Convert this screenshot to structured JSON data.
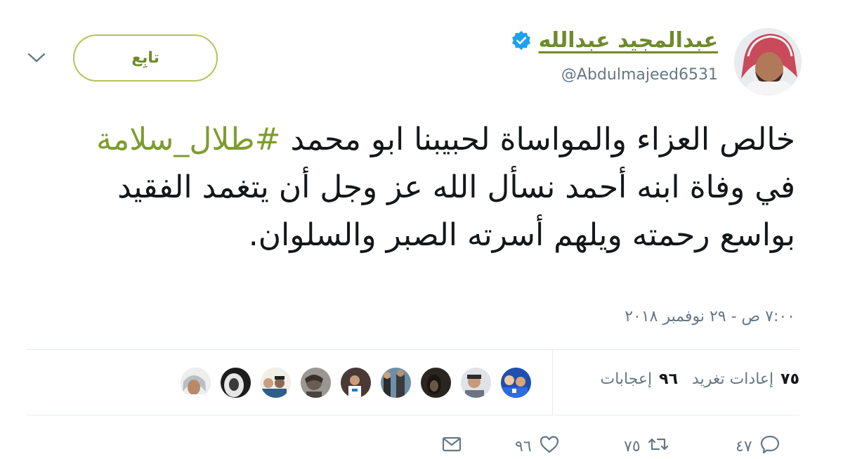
{
  "header": {
    "display_name": "عبدالمجيد عبدالله",
    "handle": "@Abdulmajeed6531",
    "verified": true,
    "follow_label": "تابِع",
    "icons": [
      "verified-badge-icon",
      "chevron-down-icon"
    ]
  },
  "tweet": {
    "text_before": "خالص العزاء والمواساة لحبيبنا ابو محمد ",
    "hashtag": "#طلال_سلامة",
    "text_after": " في وفاة ابنه أحمد نسأل الله عز وجل أن يتغمد الفقيد بواسع رحمته ويلهم أسرته الصبر والسلوان.",
    "timestamp": "٧:٠٠ ص - ٢٩ نوفمبر ٢٠١٨"
  },
  "stats": {
    "retweets_count": "٧٥",
    "retweets_label": "إعادات تغريد",
    "likes_count": "٩٦",
    "likes_label": "إعجابات"
  },
  "actions": {
    "reply_count": "٤٧",
    "retweet_count": "٧٥",
    "like_count": "٩٦",
    "icons": [
      "reply-icon",
      "retweet-icon",
      "like-icon",
      "message-icon"
    ]
  },
  "colors": {
    "accent": "#7e9c2e",
    "muted": "#657786",
    "text": "#14171a",
    "verified": "#1da1f2"
  }
}
